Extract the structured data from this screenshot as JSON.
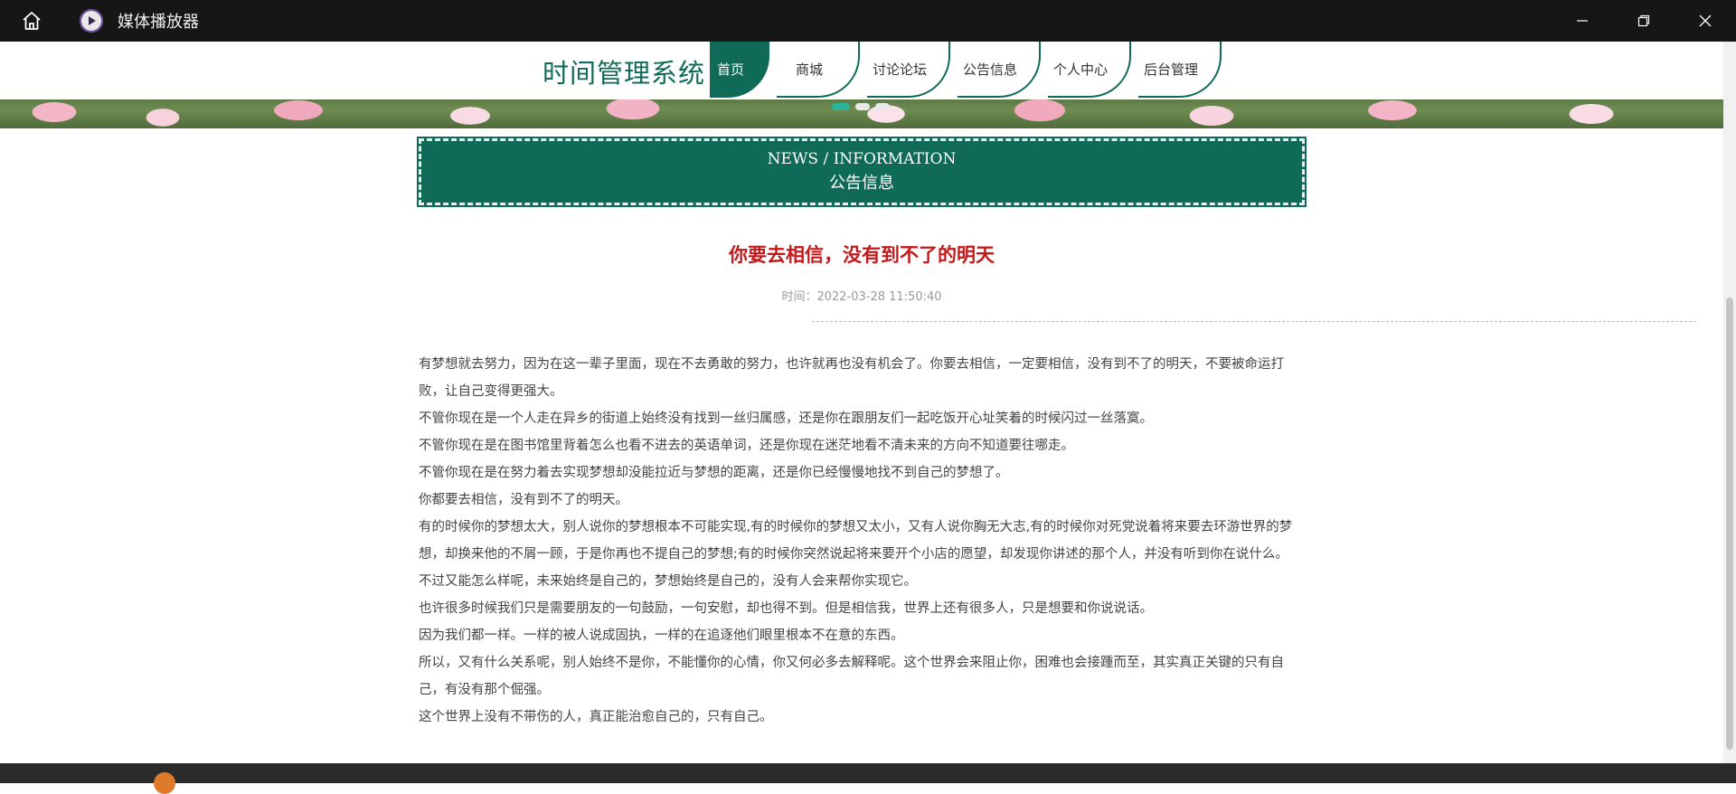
{
  "window": {
    "app_title": "媒体播放器",
    "controls": [
      "minimize",
      "restore",
      "close"
    ]
  },
  "site": {
    "title": "时间管理系统",
    "nav": [
      {
        "label": "首页",
        "active": true
      },
      {
        "label": "商城",
        "active": false
      },
      {
        "label": "讨论论坛",
        "active": false
      },
      {
        "label": "公告信息",
        "active": false
      },
      {
        "label": "个人中心",
        "active": false
      },
      {
        "label": "后台管理",
        "active": false
      }
    ]
  },
  "section": {
    "english": "NEWS / INFORMATION",
    "chinese": "公告信息"
  },
  "article": {
    "title": "你要去相信，没有到不了的明天",
    "time": "时间：2022-03-28 11:50:40",
    "paragraphs": [
      "有梦想就去努力，因为在这一辈子里面，现在不去勇敢的努力，也许就再也没有机会了。你要去相信，一定要相信，没有到不了的明天，不要被命运打败，让自己变得更强大。",
      "不管你现在是一个人走在异乡的街道上始终没有找到一丝归属感，还是你在跟朋友们一起吃饭开心址笑着的时候闪过一丝落寞。",
      "不管你现在是在图书馆里背着怎么也看不进去的英语单词，还是你现在迷茫地看不清未来的方向不知道要往哪走。",
      "不管你现在是在努力着去实现梦想却没能拉近与梦想的距离，还是你已经慢慢地找不到自己的梦想了。",
      "你都要去相信，没有到不了的明天。",
      "有的时候你的梦想太大，别人说你的梦想根本不可能实现,有的时候你的梦想又太小，又有人说你胸无大志,有的时候你对死党说着将来要去环游世界的梦想，却换来他的不屑一顾，于是你再也不提自己的梦想;有的时候你突然说起将来要开个小店的愿望，却发现你讲述的那个人，并没有听到你在说什么。",
      "不过又能怎么样呢，未来始终是自己的，梦想始终是自己的，没有人会来帮你实现它。",
      "也许很多时候我们只是需要朋友的一句鼓励，一句安慰，却也得不到。但是相信我，世界上还有很多人，只是想要和你说说话。",
      "因为我们都一样。一样的被人说成固执，一样的在追逐他们眼里根本不在意的东西。",
      "所以，又有什么关系呢，别人始终不是你，不能懂你的心情，你又何必多去解释呢。这个世界会来阻止你，困难也会接踵而至，其实真正关键的只有自己，有没有那个倔强。",
      "这个世界上没有不带伤的人，真正能治愈自己的，只有自己。"
    ]
  },
  "icons": [
    "home-icon",
    "play-logo-icon",
    "minimize-icon",
    "restore-icon",
    "close-icon"
  ],
  "colors": {
    "brand": "#0f6b57",
    "title_red": "#c4191b",
    "titlebar": "#161616"
  }
}
